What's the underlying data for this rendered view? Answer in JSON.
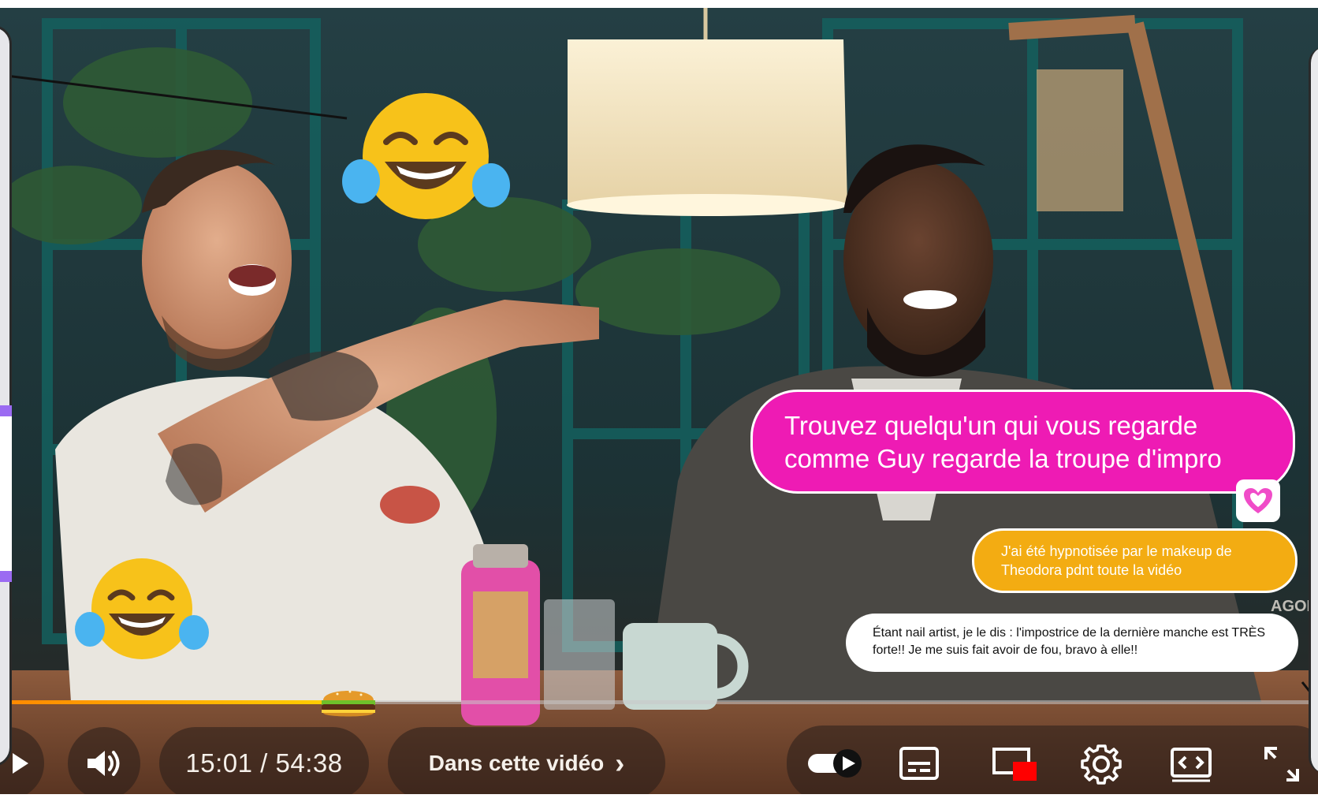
{
  "player": {
    "time_display": "15:01 / 54:38",
    "chapter_label": "Dans cette vidéo",
    "chapter_chevron": "›",
    "progress_fraction": 0.274,
    "accent_color": "#ffcc00"
  },
  "comments": {
    "pink": "Trouvez quelqu'un qui vous regarde comme Guy regarde la troupe d'impro",
    "orange": "J'ai été hypnotisée par le makeup de Theodora pdnt toute la vidéo",
    "white": "Étant nail artist, je le dis : l'impostrice de la dernière manche est TRÈS forte!! Je me suis fait avoir de fou, bravo à elle!!"
  },
  "scene_text": {
    "wall_text": "AGONNE"
  },
  "icons": {
    "play": "play-icon",
    "volume": "volume-icon",
    "autoplay": "autoplay-toggle-icon",
    "subtitles": "subtitles-icon",
    "miniplayer": "miniplayer-icon",
    "settings": "gear-icon",
    "theater": "theater-mode-icon",
    "fullscreen": "fullscreen-icon",
    "heart": "heart-icon",
    "laugh": "laughing-emoji-icon",
    "progress_thumb": "burger-icon"
  },
  "colors": {
    "pink_bubble": "#ee1bb4",
    "orange_bubble": "#f3ac12",
    "left_panel_accent": "#9b6bf2"
  }
}
